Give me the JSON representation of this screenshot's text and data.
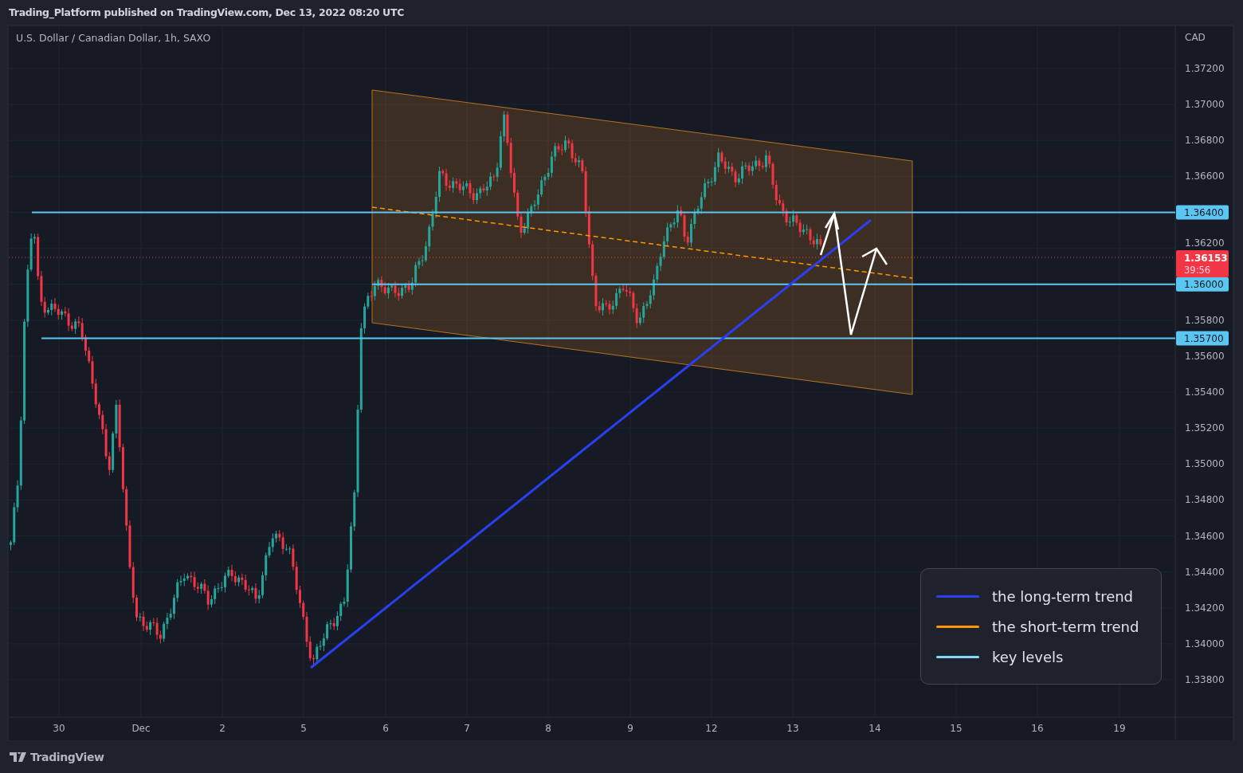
{
  "header": {
    "title": "Trading_Platform published on TradingView.com, Dec 13, 2022 08:20 UTC"
  },
  "chart": {
    "symbol": "U.S. Dollar / Canadian Dollar, 1h, SAXO",
    "currency": "CAD",
    "price_ticks": [
      "1.37200",
      "1.37000",
      "1.36800",
      "1.36600",
      "1.36200",
      "1.35800",
      "1.35600",
      "1.35400",
      "1.35200",
      "1.35000",
      "1.34800",
      "1.34600",
      "1.34400",
      "1.34200",
      "1.34000",
      "1.33800"
    ],
    "level_labels": [
      {
        "text": "1.36400"
      },
      {
        "text": "1.36000"
      },
      {
        "text": "1.35700"
      }
    ],
    "current_price": {
      "price": "1.36153",
      "countdown": "39:56"
    },
    "time_ticks": [
      "30",
      "Dec",
      "2",
      "5",
      "6",
      "7",
      "8",
      "9",
      "12",
      "13",
      "14",
      "15",
      "16",
      "19"
    ],
    "legend": [
      {
        "label": "the long-term trend",
        "color": "#2a3ff0"
      },
      {
        "label": "the short-term trend",
        "color": "#ff9800"
      },
      {
        "label": "key levels",
        "color": "#7fd8f5"
      }
    ]
  },
  "footer": {
    "brand": "TradingView"
  }
}
